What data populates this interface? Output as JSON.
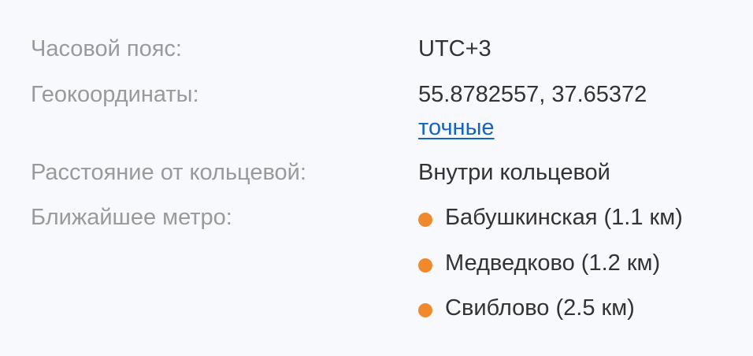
{
  "details": {
    "timezone": {
      "label": "Часовой пояс:",
      "value": "UTC+3"
    },
    "geocoords": {
      "label": "Геокоординаты:",
      "value": "55.8782557, 37.65372",
      "link": "точные"
    },
    "ring_distance": {
      "label": "Расстояние от кольцевой:",
      "value": "Внутри кольцевой"
    },
    "nearest_metro": {
      "label": "Ближайшее метро:",
      "line_color": "#f0882c",
      "stations": [
        "Бабушкинская (1.1 км)",
        "Медведково (1.2 км)",
        "Свиблово (2.5 км)"
      ]
    }
  }
}
